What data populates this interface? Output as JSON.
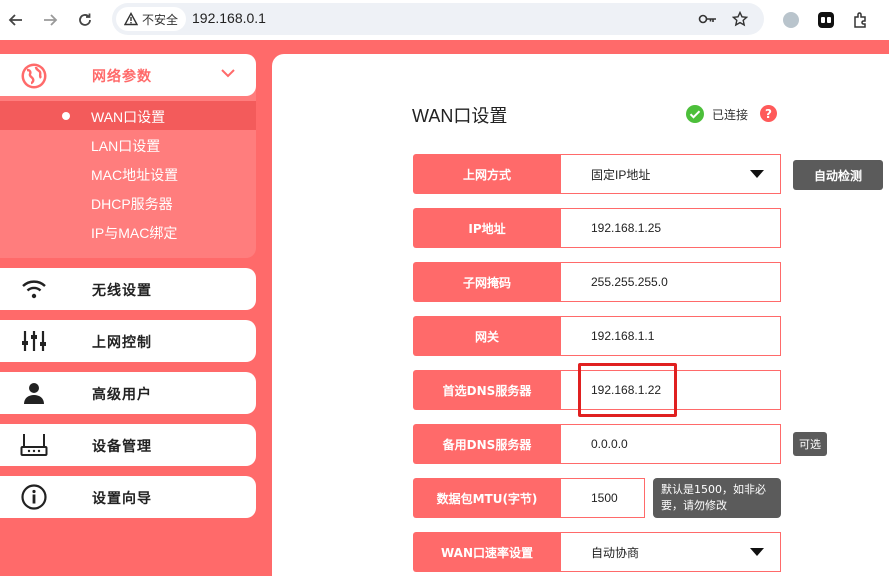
{
  "browser": {
    "url": "192.168.0.1",
    "security_label": "不安全"
  },
  "sidebar": {
    "group": {
      "label": "网络参数",
      "items": [
        {
          "label": "WAN口设置",
          "active": true
        },
        {
          "label": "LAN口设置"
        },
        {
          "label": "MAC地址设置"
        },
        {
          "label": "DHCP服务器"
        },
        {
          "label": "IP与MAC绑定"
        }
      ]
    },
    "menus": [
      {
        "label": "无线设置",
        "icon": "wifi-icon"
      },
      {
        "label": "上网控制",
        "icon": "sliders-icon"
      },
      {
        "label": "高级用户",
        "icon": "user-icon"
      },
      {
        "label": "设备管理",
        "icon": "router-icon"
      },
      {
        "label": "设置向导",
        "icon": "info-icon"
      }
    ]
  },
  "main": {
    "title": "WAN口设置",
    "status": "已连接",
    "help": "?",
    "auto_detect": "自动检测",
    "optional": "可选",
    "mtu_hint": "默认是1500，如非必要，请勿修改",
    "fields": {
      "conn_type": {
        "label": "上网方式",
        "value": "固定IP地址"
      },
      "ip": {
        "label": "IP地址",
        "value": "192.168.1.25"
      },
      "mask": {
        "label": "子网掩码",
        "value": "255.255.255.0"
      },
      "gateway": {
        "label": "网关",
        "value": "192.168.1.1"
      },
      "dns1": {
        "label": "首选DNS服务器",
        "value": "192.168.1.22"
      },
      "dns2": {
        "label": "备用DNS服务器",
        "value": "0.0.0.0"
      },
      "mtu": {
        "label": "数据包MTU(字节)",
        "value": "1500"
      },
      "speed": {
        "label": "WAN口速率设置",
        "value": "自动协商"
      }
    }
  },
  "colors": {
    "accent": "#ff6a6a",
    "dark_button": "#5b5b5b",
    "connected": "#4cbf3a",
    "highlight": "#e02020"
  }
}
